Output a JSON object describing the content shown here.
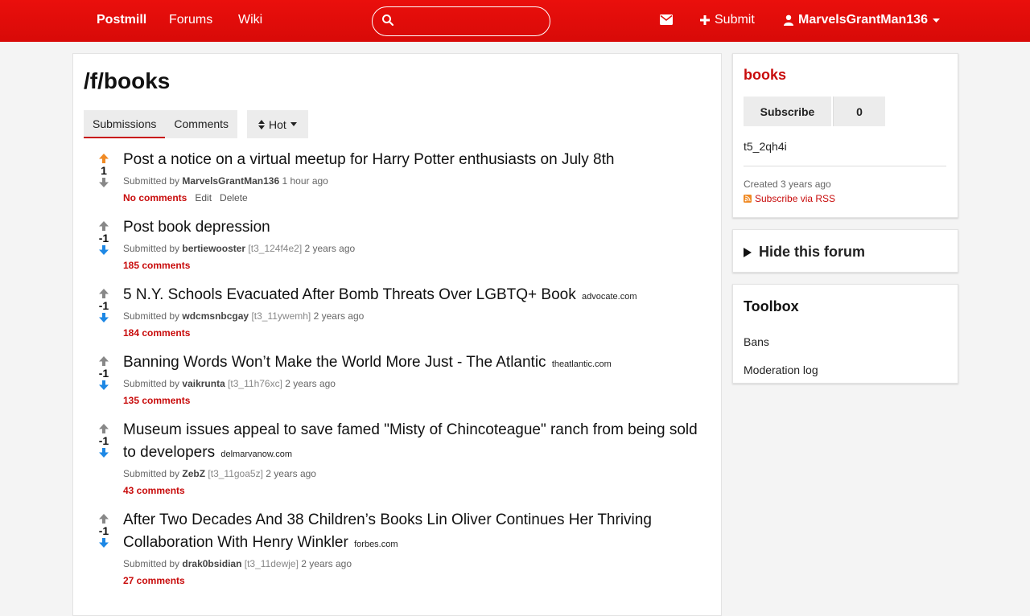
{
  "header": {
    "brand": "Postmill",
    "nav_forums": "Forums",
    "nav_wiki": "Wiki",
    "search_placeholder": "",
    "submit_label": "Submit",
    "username": "MarvelsGrantMan136"
  },
  "main": {
    "title": "/f/books",
    "tab_submissions": "Submissions",
    "tab_comments": "Comments",
    "sort_label": "Hot",
    "posts": [
      {
        "score": "1",
        "upvoted": true,
        "title": "Post a notice on a virtual meetup for Harry Potter enthusiasts on July 8th",
        "domain": "",
        "submitted_by": "Submitted by",
        "author": "MarvelsGrantMan136",
        "post_id": "",
        "time": "1 hour ago",
        "comments": "No comments",
        "edit": "Edit",
        "delete": "Delete"
      },
      {
        "score": "-1",
        "title": "Post book depression",
        "domain": "",
        "submitted_by": "Submitted by",
        "author": "bertiewooster",
        "post_id": "[t3_124f4e2]",
        "time": "2 years ago",
        "comments": "185 comments"
      },
      {
        "score": "-1",
        "title": "5 N.Y. Schools Evacuated After Bomb Threats Over LGBTQ+ Book",
        "domain": "advocate.com",
        "submitted_by": "Submitted by",
        "author": "wdcmsnbcgay",
        "post_id": "[t3_11ywemh]",
        "time": "2 years ago",
        "comments": "184 comments"
      },
      {
        "score": "-1",
        "title": "Banning Words Won’t Make the World More Just - The Atlantic",
        "domain": "theatlantic.com",
        "submitted_by": "Submitted by",
        "author": "vaikrunta",
        "post_id": "[t3_11h76xc]",
        "time": "2 years ago",
        "comments": "135 comments"
      },
      {
        "score": "-1",
        "title": "Museum issues appeal to save famed \"Misty of Chincoteague\" ranch from being sold to developers",
        "domain": "delmarvanow.com",
        "submitted_by": "Submitted by",
        "author": "ZebZ",
        "post_id": "[t3_11goa5z]",
        "time": "2 years ago",
        "comments": "43 comments"
      },
      {
        "score": "-1",
        "title": "After Two Decades And 38 Children’s Books Lin Oliver Continues Her Thriving Collaboration With Henry Winkler",
        "domain": "forbes.com",
        "submitted_by": "Submitted by",
        "author": "drak0bsidian",
        "post_id": "[t3_11dewje]",
        "time": "2 years ago",
        "comments": "27 comments"
      }
    ]
  },
  "sidebar": {
    "forum_name": "books",
    "subscribe_label": "Subscribe",
    "subscriber_count": "0",
    "forum_id": "t5_2qh4i",
    "created": "Created 3 years ago",
    "rss": "Subscribe via RSS",
    "hide_forum": "Hide this forum",
    "toolbox_title": "Toolbox",
    "bans": "Bans",
    "moderation_log": "Moderation log"
  },
  "colors": {
    "brand_red": "#e00d0b",
    "link_red": "#c80b0b",
    "upvote_orange": "#f08a24",
    "downvote_blue": "#1e88e5"
  }
}
